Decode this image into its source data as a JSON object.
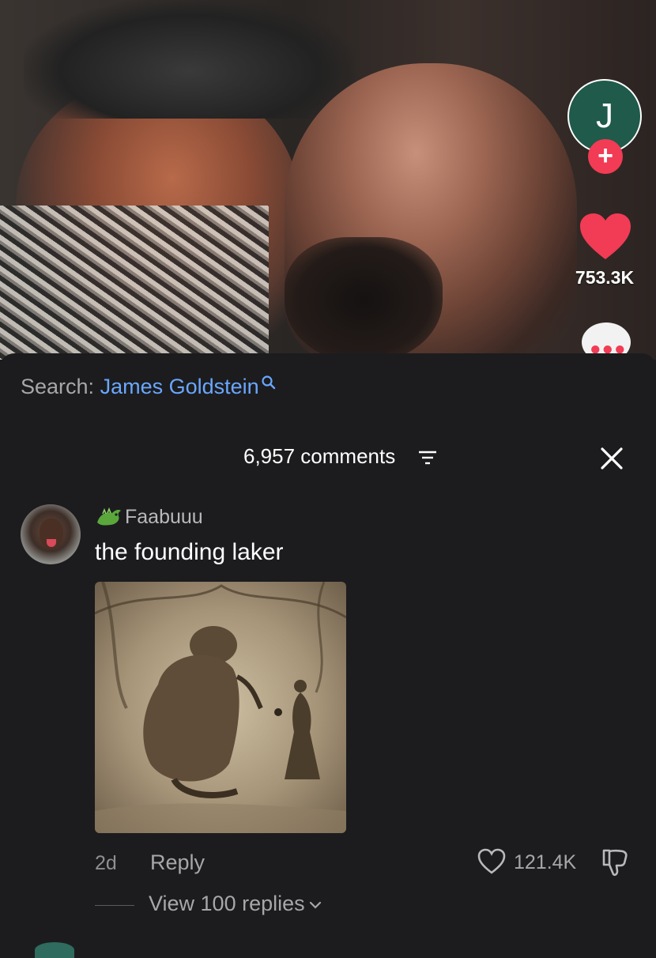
{
  "video": {
    "creator_initial": "J",
    "like_count": "753.3K",
    "colors": {
      "follow_badge": "#f23b54",
      "like_heart": "#f23b54",
      "avatar_bg": "#1f5a4a"
    }
  },
  "comments_sheet": {
    "search_label": "Search:",
    "search_term": "James Goldstein",
    "comment_count_label": "6,957 comments",
    "colors": {
      "link": "#6aa7ff",
      "sheet_bg": "#1c1c1e"
    }
  },
  "comment": {
    "username": "Faabuuu",
    "text": "the founding laker",
    "time": "2d",
    "reply_label": "Reply",
    "like_count": "121.4K",
    "view_replies_label": "View 100 replies"
  }
}
